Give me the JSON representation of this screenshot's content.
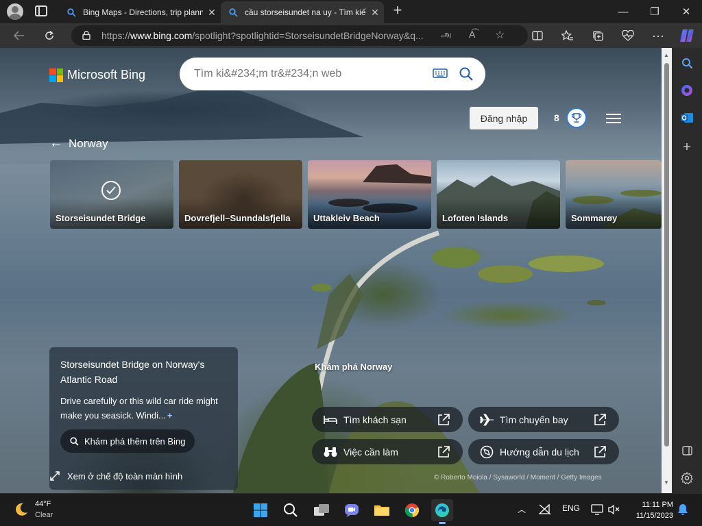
{
  "tabs": [
    {
      "title": "Bing Maps - Directions, trip plann",
      "close": "✕"
    },
    {
      "title": "cầu storseisundet na uy - Tìm kiế",
      "close": "✕"
    }
  ],
  "window": {
    "minimize": "—",
    "maximize": "❐",
    "close": "✕"
  },
  "address": {
    "prefix": "https://",
    "domain": "www.bing.com",
    "path": "/spotlight?spotlightid=StorseisundetBridgeNorway&q..."
  },
  "brand": {
    "name": "Microsoft Bing"
  },
  "search": {
    "placeholder": "Tìm ki&#234;m tr&#234;n web"
  },
  "header": {
    "sign_in": "Đăng nhập",
    "points": "8"
  },
  "spotlight": {
    "back_label": "Norway",
    "cards": [
      {
        "label": "Storseisundet Bridge",
        "selected": true
      },
      {
        "label": "Dovrefjell–Sunndalsfjella",
        "selected": false
      },
      {
        "label": "Uttakleiv Beach",
        "selected": false
      },
      {
        "label": "Lofoten Islands",
        "selected": false
      },
      {
        "label": "Sommarøy",
        "selected": false
      }
    ]
  },
  "info": {
    "title": "Storseisundet Bridge on Norway's Atlantic Road",
    "description": "Drive carefully or this wild car ride might make you seasick. Windi...",
    "more": "+",
    "explore_button": "Khám phá thêm trên Bing",
    "fullscreen": "Xem ở chế độ toàn màn hình"
  },
  "discover": {
    "title": "Khám phá Norway",
    "buttons": [
      {
        "label": "Tìm khách sạn",
        "icon": "bed-icon"
      },
      {
        "label": "Tìm chuyến bay",
        "icon": "plane-icon"
      },
      {
        "label": "Việc cần làm",
        "icon": "binoculars-icon"
      },
      {
        "label": "Hướng dẫn du lịch",
        "icon": "compass-icon"
      }
    ]
  },
  "credit": "© Roberto Moiola / Sysaworld / Moment / Getty Images",
  "taskbar": {
    "temperature": "44°F",
    "condition": "Clear",
    "language": "ENG",
    "time": "11:11 PM",
    "date": "11/15/2023"
  },
  "colors": {
    "accent": "#2d7dd2",
    "bing_red": "#f25022",
    "bing_green": "#7fba00",
    "bing_blue": "#00a4ef",
    "bing_yellow": "#ffb900"
  }
}
